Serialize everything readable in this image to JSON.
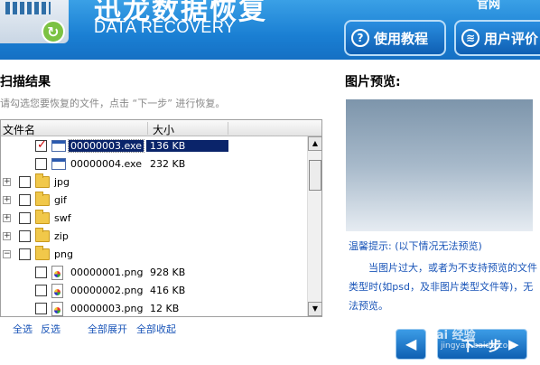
{
  "header": {
    "brand_cn": "迅龙数据恢复",
    "brand_en": "DATA RECOVERY",
    "corner_link": "官网",
    "tutorial_button": "使用教程",
    "review_button": "用户评价"
  },
  "scan": {
    "title": "扫描结果",
    "description": "请勾选您要恢复的文件，点击 “下一步” 进行恢复。",
    "columns": {
      "name": "文件名",
      "size": "大小"
    },
    "rows": [
      {
        "name": "00000003.exe",
        "size": "136 KB",
        "type": "exe",
        "checked": true,
        "selected": true
      },
      {
        "name": "00000004.exe",
        "size": "232 KB",
        "type": "exe",
        "checked": false
      },
      {
        "name": "jpg",
        "type": "folder",
        "expander": "+"
      },
      {
        "name": "gif",
        "type": "folder",
        "expander": "+"
      },
      {
        "name": "swf",
        "type": "folder",
        "expander": "+"
      },
      {
        "name": "zip",
        "type": "folder",
        "expander": "+"
      },
      {
        "name": "png",
        "type": "folder",
        "expander": "−"
      },
      {
        "name": "00000001.png",
        "size": "928 KB",
        "type": "png",
        "checked": false
      },
      {
        "name": "00000002.png",
        "size": "416 KB",
        "type": "png",
        "checked": false
      },
      {
        "name": "00000003.png",
        "size": "12 KB",
        "type": "png",
        "checked": false
      }
    ],
    "links": {
      "select_all": "全选",
      "invert": "反选",
      "expand_all": "全部展开",
      "collapse_all": "全部收起"
    }
  },
  "preview": {
    "title": "图片预览:",
    "tip_title": "温馨提示: (以下情况无法预览)",
    "tip_body": "当图片过大，或者为不支持预览的文件类型时(如psd，及非图片类型文件等)，无法预览。"
  },
  "nav": {
    "prev_label": "◀",
    "next_label": "下一步",
    "next_arrow": "▶"
  },
  "watermark": {
    "text": "Bai 经验",
    "url": "jingyan.baidu.com"
  },
  "colors": {
    "header_blue": "#1a7fd3",
    "link_blue": "#1a55b8",
    "selection": "#0a246a"
  }
}
